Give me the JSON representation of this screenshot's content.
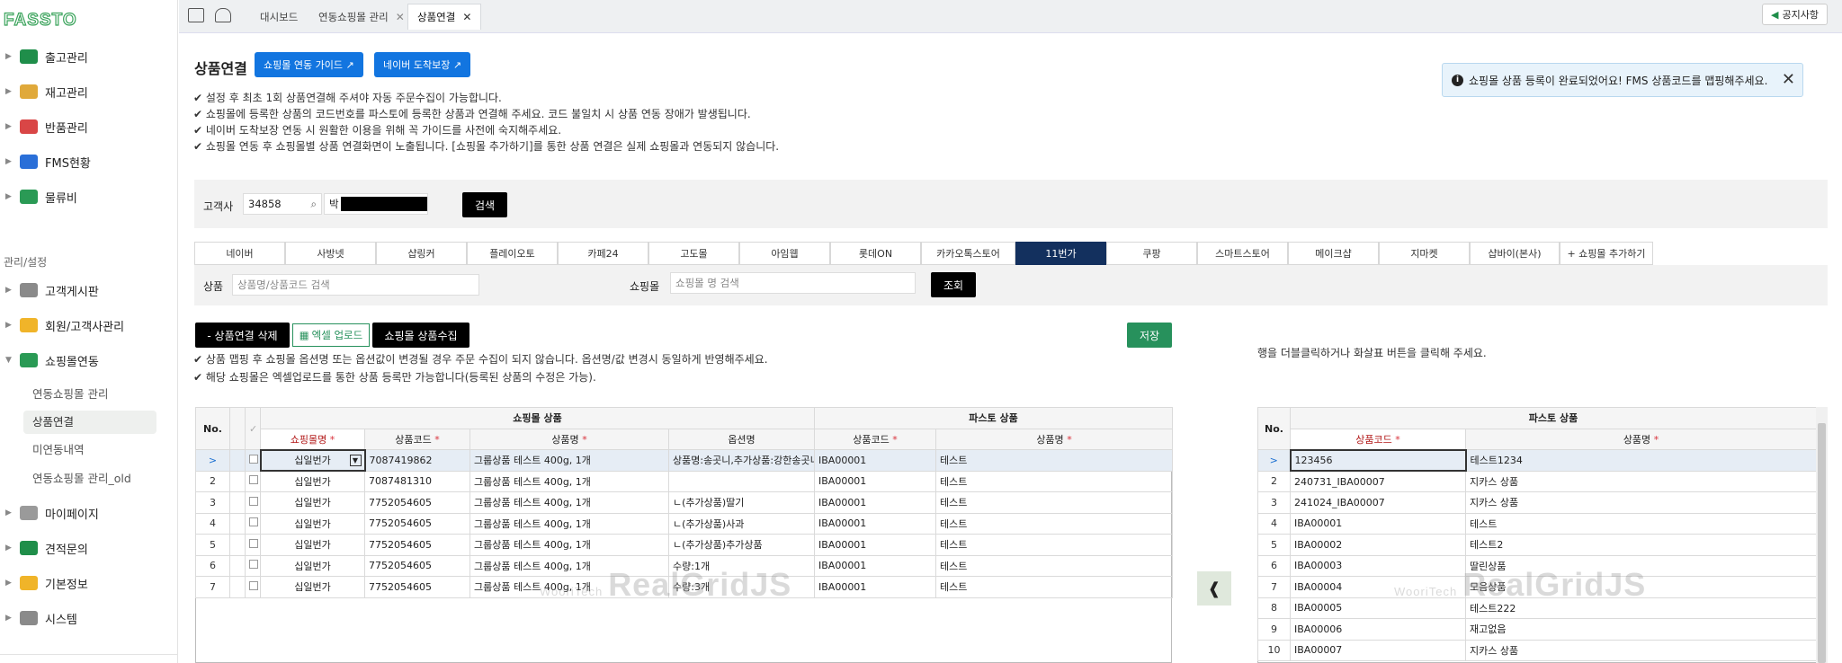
{
  "app": {
    "logo": "FASSTO"
  },
  "sidebar": {
    "items": [
      {
        "label": "출고관리",
        "icon": "truck-icon",
        "color": "#1f8e4a"
      },
      {
        "label": "재고관리",
        "icon": "box-icon",
        "color": "#e0a93a"
      },
      {
        "label": "반품관리",
        "icon": "return-icon",
        "color": "#d94646"
      },
      {
        "label": "FMS현황",
        "icon": "chart-icon",
        "color": "#2a6fd8"
      },
      {
        "label": "물류비",
        "icon": "book-icon",
        "color": "#2a9a55"
      }
    ],
    "section_label": "관리/설정",
    "settings_items": [
      {
        "label": "고객게시판",
        "icon": "chat-icon",
        "color": "#8a8a8a"
      },
      {
        "label": "회원/고객사관리",
        "icon": "card-icon",
        "color": "#f0b429"
      },
      {
        "label": "쇼핑몰연동",
        "icon": "link-icon",
        "color": "#2a9a55"
      }
    ],
    "submenu": [
      "연동쇼핑몰 관리",
      "상품연결",
      "미연동내역",
      "연동쇼핑몰 관리_old"
    ],
    "bottom_items": [
      {
        "label": "마이페이지",
        "icon": "user-icon",
        "color": "#9a9a9a"
      },
      {
        "label": "견적문의",
        "icon": "phone-icon",
        "color": "#1f8e4a"
      },
      {
        "label": "기본정보",
        "icon": "note-icon",
        "color": "#f0b429"
      },
      {
        "label": "시스템",
        "icon": "gear-icon",
        "color": "#8a8a8a"
      }
    ]
  },
  "topbar": {
    "tabs": [
      {
        "label": "대시보드"
      },
      {
        "label": "연동쇼핑몰 관리"
      },
      {
        "label": "상품연결"
      }
    ],
    "notice": "공지사항"
  },
  "page": {
    "title": "상품연결",
    "guide_button": "쇼핑몰 연동 가이드 ↗",
    "naver_button": "네이버 도착보장 ↗",
    "guides": [
      "✔ 설정 후 최초 1회 상품연결해 주셔야 자동 주문수집이 가능합니다.",
      "✔ 쇼핑몰에 등록한 상품의 코드번호를 파스토에 등록한 상품과 연결해 주세요. 코드 불일치 시 상품 연동 장애가 발생됩니다.",
      "✔ 네이버 도착보장 연동 시 원활한 이용을 위해 꼭 가이드를 사전에 숙지해주세요.",
      "✔ 쇼핑몰 연동 후 쇼핑몰별 상품 연결화면이 노출됩니다. [쇼핑몰 추가하기]를 통한 상품 연결은 실제 쇼핑몰과 연동되지 않습니다."
    ],
    "toast": "쇼핑몰 상품 등록이 완료되었어요! FMS 상품코드를 맵핑해주세요."
  },
  "search": {
    "customer_label": "고객사",
    "customer_code": "34858",
    "customer_name": "박",
    "search_button": "검색"
  },
  "mall_tabs": [
    "네이버",
    "사방넷",
    "샵링커",
    "플레이오토",
    "카페24",
    "고도몰",
    "아임웹",
    "롯데ON",
    "카카오톡스토어",
    "11번가",
    "쿠팡",
    "스마트스토어",
    "메이크샵",
    "지마켓",
    "샵바이(본사)",
    "+ 쇼핑몰 추가하기"
  ],
  "filter": {
    "product_label": "상품",
    "product_placeholder": "상품명/상품코드 검색",
    "mall_label": "쇼핑몰",
    "mall_placeholder": "쇼핑몰 명 검색",
    "query_button": "조회"
  },
  "actions": {
    "delete_button": "- 상품연결 삭제",
    "excel_button": "엑셀 업로드",
    "collect_button": "쇼핑몰 상품수집",
    "save_button": "저장",
    "notes": [
      "✔ 상품 맵핑 후 쇼핑몰 옵션명 또는 옵션값이 변경될 경우 주문 수집이 되지 않습니다. 옵션명/값 변경시 동일하게 반영해주세요.",
      "✔ 해당 쇼핑몰은 엑셀업로드를 통한 상품 등록만 가능합니다(등록된 상품의 수정은 가능)."
    ],
    "right_hint": "행을 더블클릭하거나 화살표 버튼을 클릭해 주세요."
  },
  "left_grid": {
    "group_mall": "쇼핑몰 상품",
    "group_fassto": "파스토 상품",
    "col_no": "No.",
    "check_mark": "✓",
    "columns": [
      "쇼핑몰명",
      "상품코드",
      "상품명",
      "옵션명",
      "상품코드",
      "상품명"
    ],
    "rows": [
      {
        "no": ">",
        "mall": "십일번가",
        "code": "7087419862",
        "name": "그룹상품 테스트 400g, 1개",
        "option": "상품명:송곳니,추가상품:강한송곳니",
        "fcode": "IBA00001",
        "fname": "테스트"
      },
      {
        "no": "2",
        "mall": "십일번가",
        "code": "7087481310",
        "name": "그룹상품 테스트 400g, 1개",
        "option": "",
        "fcode": "IBA00001",
        "fname": "테스트"
      },
      {
        "no": "3",
        "mall": "십일번가",
        "code": "7752054605",
        "name": "그룹상품 테스트 400g, 1개",
        "option": "ㄴ(추가상품)딸기",
        "fcode": "IBA00001",
        "fname": "테스트"
      },
      {
        "no": "4",
        "mall": "십일번가",
        "code": "7752054605",
        "name": "그룹상품 테스트 400g, 1개",
        "option": "ㄴ(추가상품)사과",
        "fcode": "IBA00001",
        "fname": "테스트"
      },
      {
        "no": "5",
        "mall": "십일번가",
        "code": "7752054605",
        "name": "그룹상품 테스트 400g, 1개",
        "option": "ㄴ(추가상품)추가상품",
        "fcode": "IBA00001",
        "fname": "테스트"
      },
      {
        "no": "6",
        "mall": "십일번가",
        "code": "7752054605",
        "name": "그룹상품 테스트 400g, 1개",
        "option": "수량:1개",
        "fcode": "IBA00001",
        "fname": "테스트"
      },
      {
        "no": "7",
        "mall": "십일번가",
        "code": "7752054605",
        "name": "그룹상품 테스트 400g, 1개",
        "option": "수량:3개",
        "fcode": "IBA00001",
        "fname": "테스트"
      }
    ]
  },
  "right_grid": {
    "group": "파스토 상품",
    "col_no": "No.",
    "columns": [
      "상품코드",
      "상품명"
    ],
    "rows": [
      {
        "no": ">",
        "code": "123456",
        "name": "테스트1234"
      },
      {
        "no": "2",
        "code": "240731_IBA00007",
        "name": "지카스 상품"
      },
      {
        "no": "3",
        "code": "241024_IBA00007",
        "name": "지카스 상품"
      },
      {
        "no": "4",
        "code": "IBA00001",
        "name": "테스트"
      },
      {
        "no": "5",
        "code": "IBA00002",
        "name": "테스트2"
      },
      {
        "no": "6",
        "code": "IBA00003",
        "name": "딸린상품"
      },
      {
        "no": "7",
        "code": "IBA00004",
        "name": "모음상품"
      },
      {
        "no": "8",
        "code": "IBA00005",
        "name": "테스트222"
      },
      {
        "no": "9",
        "code": "IBA00006",
        "name": "재고없음"
      },
      {
        "no": "10",
        "code": "IBA00007",
        "name": "지카스 상품"
      }
    ]
  },
  "watermark": {
    "small": "WooriTech",
    "big": "RealGridJS"
  },
  "move_button": "❰"
}
